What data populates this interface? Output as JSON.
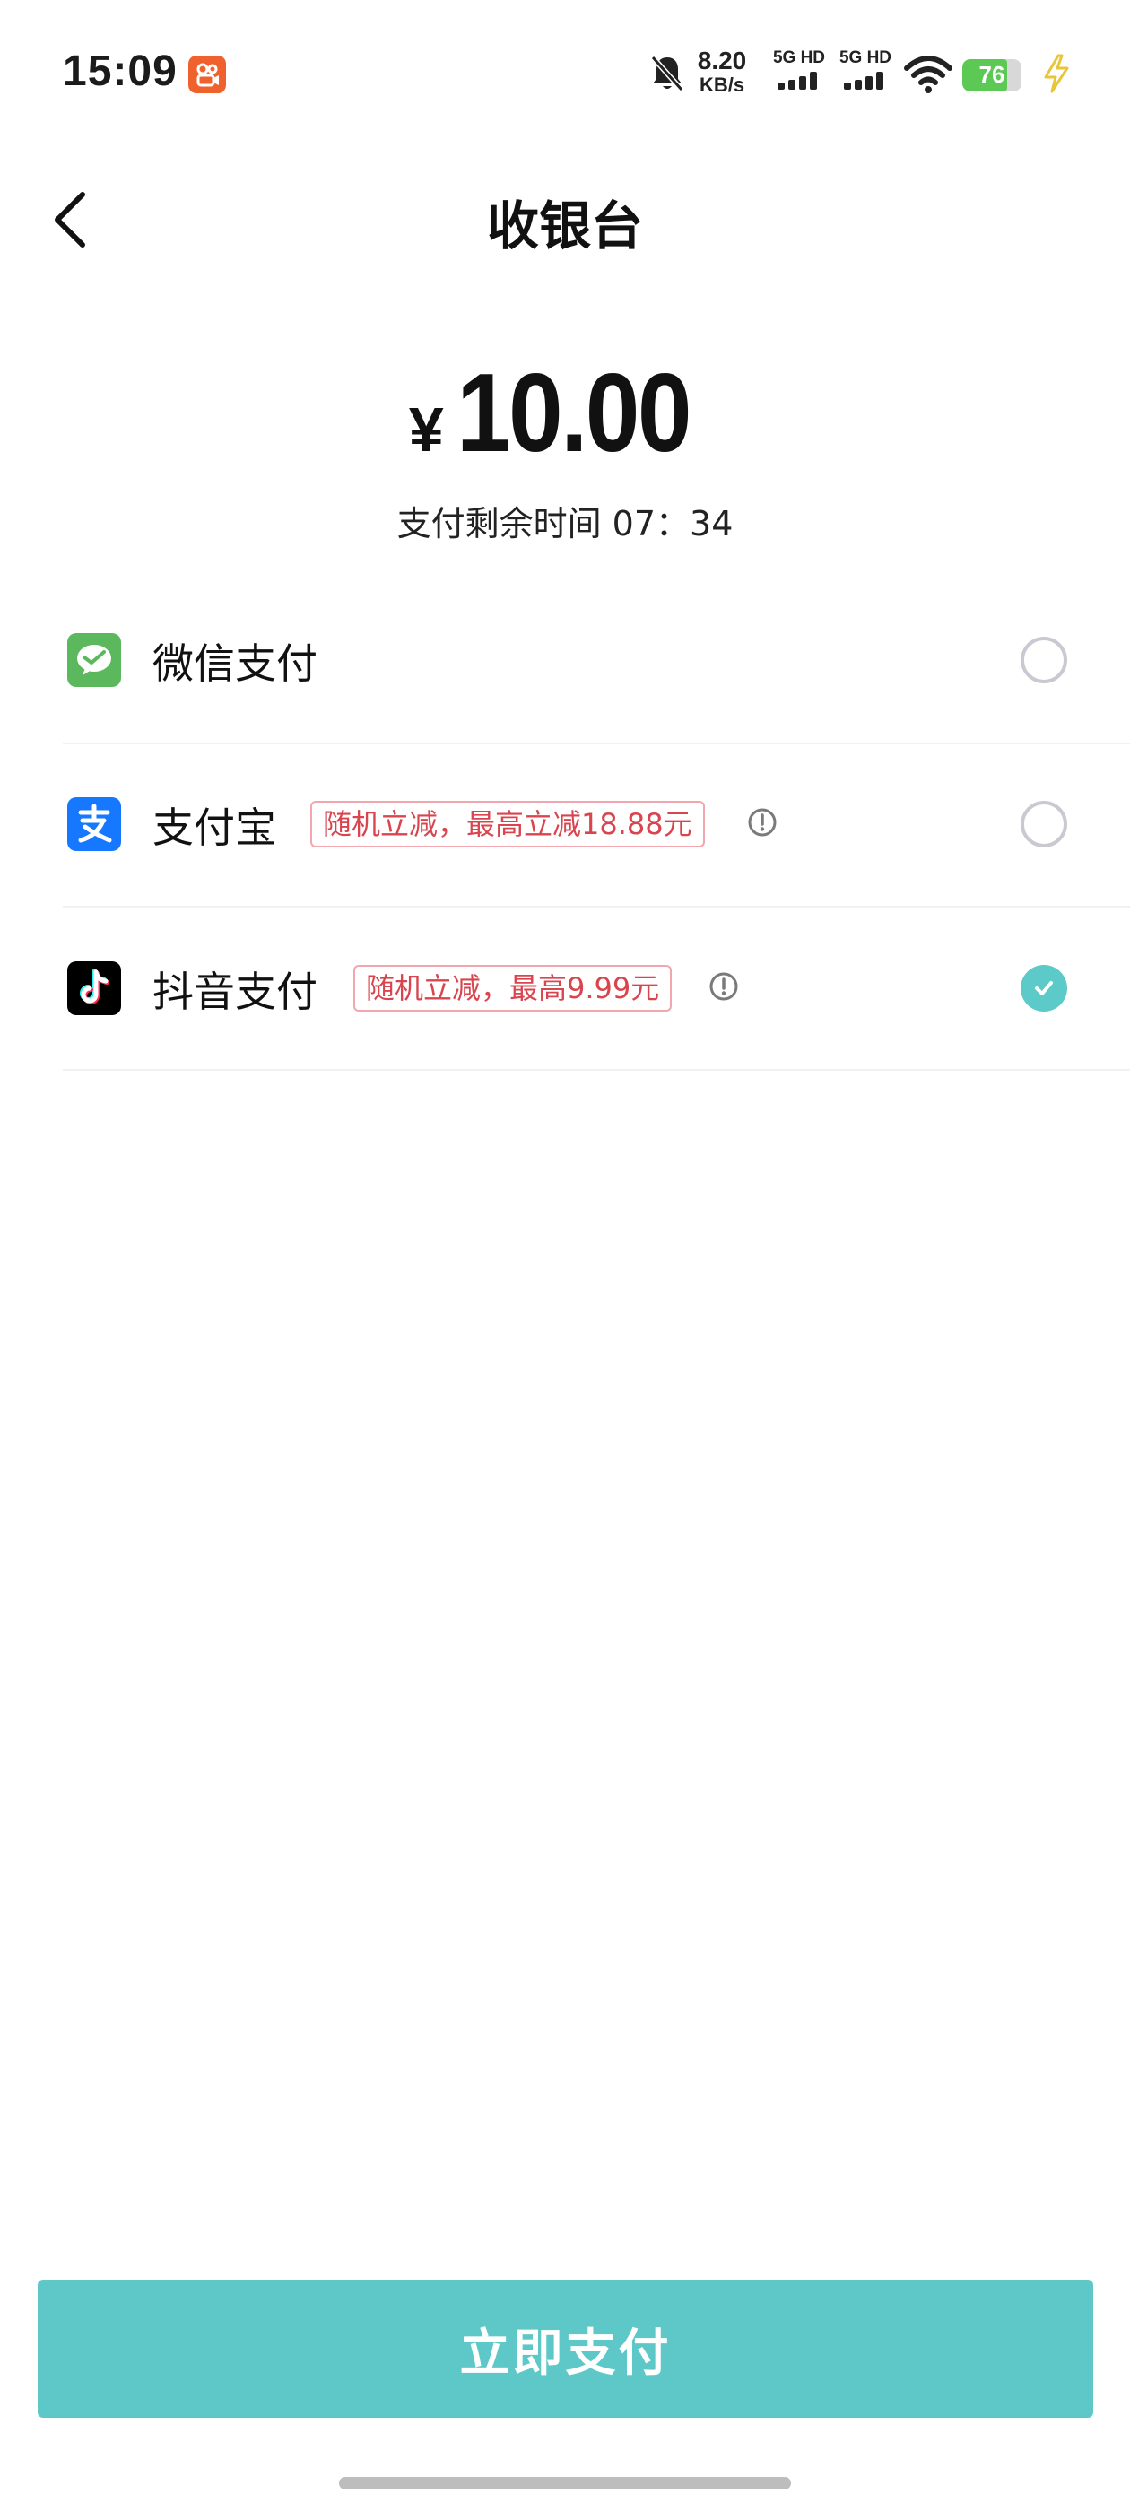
{
  "status_bar": {
    "time": "15:09",
    "net_speed_value": "8.20",
    "net_speed_unit": "KB/s",
    "sim1_label": "5G HD",
    "sim2_label": "5G HD",
    "battery_level": "76",
    "battery_fraction": 0.76,
    "icons": [
      "kuaishou-app-icon",
      "mute-bell-icon",
      "signal-bars-icon",
      "wifi-icon",
      "battery-icon",
      "charging-bolt-icon"
    ]
  },
  "header": {
    "title": "收银台",
    "back_icon": "chevron-left-icon"
  },
  "amount": {
    "currency": "¥",
    "value": "10.00"
  },
  "countdown": {
    "text": "支付剩余时间 07：34"
  },
  "payment_methods": [
    {
      "name": "微信支付",
      "icon": "wechat-pay-icon",
      "promo": "",
      "selected": false
    },
    {
      "name": "支付宝",
      "icon": "alipay-icon",
      "promo": "随机立减，最高立减18.88元",
      "selected": false
    },
    {
      "name": "抖音支付",
      "icon": "douyin-icon",
      "promo": "随机立减，最高9.99元",
      "selected": true
    }
  ],
  "colors": {
    "accent": "#5ec8c8",
    "promo_text": "#d8454f",
    "promo_border": "#f1a7ad",
    "wechat_green": "#5cb85c",
    "alipay_blue": "#1677ff"
  },
  "footer": {
    "pay_button_label": "立即支付"
  }
}
